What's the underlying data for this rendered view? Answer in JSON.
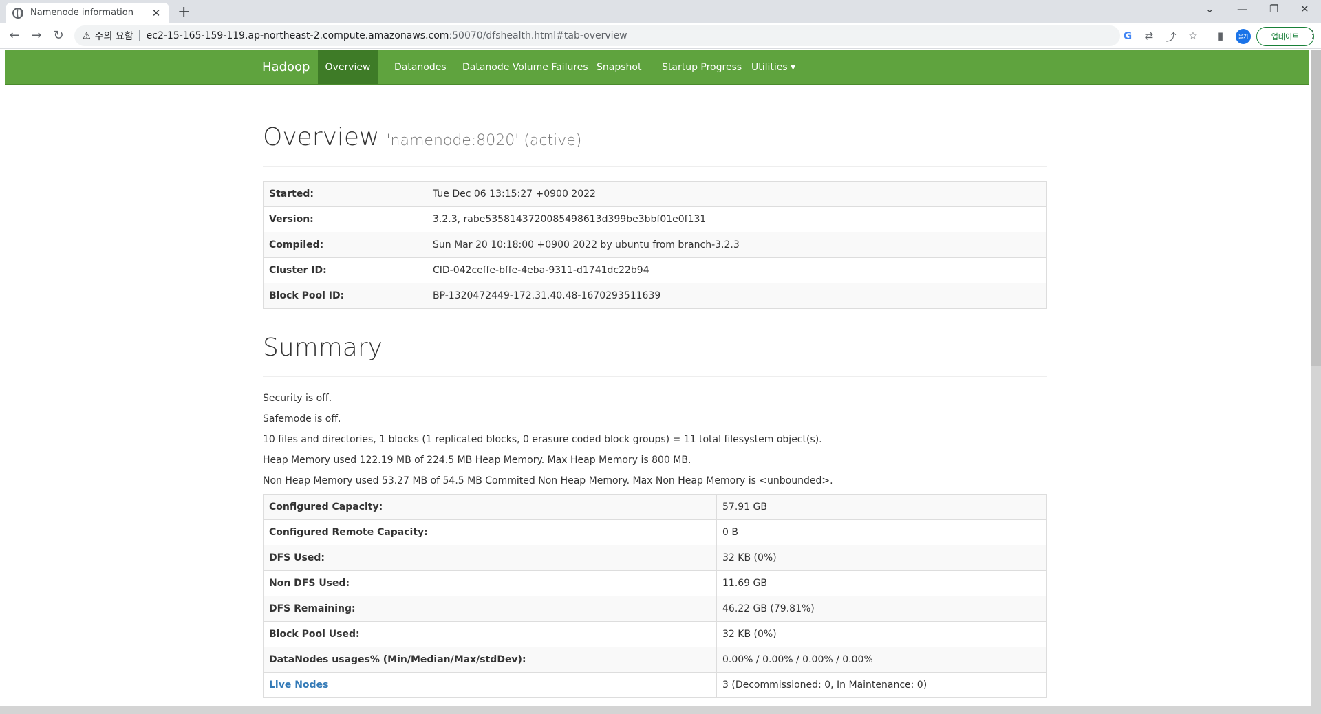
{
  "browser": {
    "tab_title": "Namenode information",
    "tab_close": "✕",
    "new_tab": "+",
    "security_icon": "⚠",
    "security_label": "주의 요함",
    "url_host": "ec2-15-165-159-119.ap-northeast-2.compute.amazonaws.com",
    "url_path": ":50070/dfshealth.html#tab-overview",
    "profile_label": "을기",
    "update_label": "업데이트",
    "icons": [
      "back-icon",
      "forward-icon",
      "reload-icon",
      "google-icon",
      "translate-icon",
      "share-icon",
      "star-icon",
      "sidepanel-icon",
      "menu-icon"
    ]
  },
  "nav": {
    "brand": "Hadoop",
    "items": [
      {
        "label": "Overview"
      },
      {
        "label": "Datanodes"
      },
      {
        "label": "Datanode Volume Failures"
      },
      {
        "label": "Snapshot"
      },
      {
        "label": "Startup Progress"
      },
      {
        "label": "Utilities ▾"
      }
    ]
  },
  "overview": {
    "title": "Overview",
    "subtitle": "'namenode:8020' (active)",
    "rows": [
      {
        "k": "Started:",
        "v": "Tue Dec 06 13:15:27 +0900 2022"
      },
      {
        "k": "Version:",
        "v": "3.2.3, rabe5358143720085498613d399be3bbf01e0f131"
      },
      {
        "k": "Compiled:",
        "v": "Sun Mar 20 10:18:00 +0900 2022 by ubuntu from branch-3.2.3"
      },
      {
        "k": "Cluster ID:",
        "v": "CID-042ceffe-bffe-4eba-9311-d1741dc22b94"
      },
      {
        "k": "Block Pool ID:",
        "v": "BP-1320472449-172.31.40.48-1670293511639"
      }
    ]
  },
  "summary": {
    "title": "Summary",
    "lines": [
      "Security is off.",
      "Safemode is off.",
      "10 files and directories, 1 blocks (1 replicated blocks, 0 erasure coded block groups) = 11 total filesystem object(s).",
      "Heap Memory used 122.19 MB of 224.5 MB Heap Memory. Max Heap Memory is 800 MB.",
      "Non Heap Memory used 53.27 MB of 54.5 MB Commited Non Heap Memory. Max Non Heap Memory is <unbounded>."
    ],
    "rows": [
      {
        "k": "Configured Capacity:",
        "v": "57.91 GB"
      },
      {
        "k": "Configured Remote Capacity:",
        "v": "0 B"
      },
      {
        "k": "DFS Used:",
        "v": "32 KB (0%)"
      },
      {
        "k": "Non DFS Used:",
        "v": "11.69 GB"
      },
      {
        "k": "DFS Remaining:",
        "v": "46.22 GB (79.81%)"
      },
      {
        "k": "Block Pool Used:",
        "v": "32 KB (0%)"
      },
      {
        "k": "DataNodes usages% (Min/Median/Max/stdDev):",
        "v": "0.00% / 0.00% / 0.00% / 0.00%"
      }
    ],
    "live_nodes": {
      "k": "Live Nodes",
      "v": "3 (Decommissioned: 0, In Maintenance: 0)"
    }
  }
}
